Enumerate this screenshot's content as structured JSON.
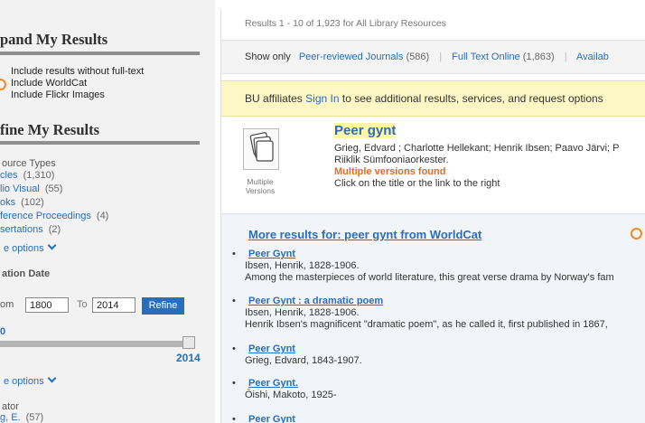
{
  "sidebar": {
    "expand_heading": "pand My Results",
    "expand_options": [
      {
        "label": "Include results without full-text"
      },
      {
        "label": "Include WorldCat"
      },
      {
        "label": "Include Flickr Images"
      }
    ],
    "refine_heading": "fine My Results",
    "source_types_heading": "ource Types",
    "source_types": [
      {
        "label": "cles",
        "count": "(1,310)"
      },
      {
        "label": "lio Visual",
        "count": "(55)"
      },
      {
        "label": "oks",
        "count": "(102)"
      },
      {
        "label": "ference Proceedings",
        "count": "(4)"
      },
      {
        "label": "sertations",
        "count": "(2)"
      }
    ],
    "more_options_1": "e options",
    "pub_date_heading": "ation Date",
    "from_label": "om",
    "from_value": "1800",
    "to_label": "To",
    "to_value": "2014",
    "refine_button": "Refine",
    "slider_min_label": "0",
    "slider_max_label": "2014",
    "slider_low_fraction": 0.0,
    "slider_high_fraction": 1.0,
    "more_options_2": "e options",
    "creator_heading": "ator",
    "creators": [
      {
        "label": "g, E.",
        "count": "(57)"
      }
    ]
  },
  "main": {
    "results_count": "Results 1 - 10 of 1,923  for All Library Resources",
    "show_only": {
      "label": "Show only",
      "filters": [
        {
          "label": "Peer-reviewed Journals",
          "count": "(586)"
        },
        {
          "label": "Full Text Online",
          "count": "(1,863)"
        },
        {
          "label": "Availab",
          "count": ""
        }
      ]
    },
    "affiliate": {
      "prefix": "BU affiliates",
      "link": "Sign In",
      "suffix": "to see additional results, services, and request options"
    },
    "top_result": {
      "icon_label": "Multiple Versions",
      "title": "Peer gynt",
      "authors": "Grieg, Edvard ; Charlotte Hellekant; Henrik Ibsen; Paavo Järvi; P",
      "publisher": "Riiklik Sümfooniaorkester.",
      "versions": "Multiple versions found",
      "hint": "Click on the title or the link to the right"
    },
    "worldcat": {
      "heading": "More results for: peer gynt from WorldCat",
      "items": [
        {
          "title": "Peer Gynt",
          "author": "Ibsen, Henrik, 1828-1906.",
          "desc": "Among the masterpieces of world literature, this great verse drama by Norway's fam"
        },
        {
          "title": "Peer Gynt : a dramatic poem",
          "author": "Ibsen, Henrik, 1828-1906.",
          "desc": "Henrik Ibsen's magnificent \"dramatic poem\", as he called it, first published in 1867,"
        },
        {
          "title": "Peer Gynt",
          "author": "Grieg, Edvard, 1843-1907.",
          "desc": ""
        },
        {
          "title": "Peer Gynt.",
          "author": "Ōishi, Makoto, 1925-",
          "desc": ""
        },
        {
          "title": "Peer Gynt",
          "author": "",
          "desc": ""
        }
      ]
    }
  },
  "colors": {
    "link": "#2a6ebb",
    "orange": "#e76b1e",
    "highlight": "#fff6a8",
    "affiliate_bg": "#fdf7c5"
  }
}
